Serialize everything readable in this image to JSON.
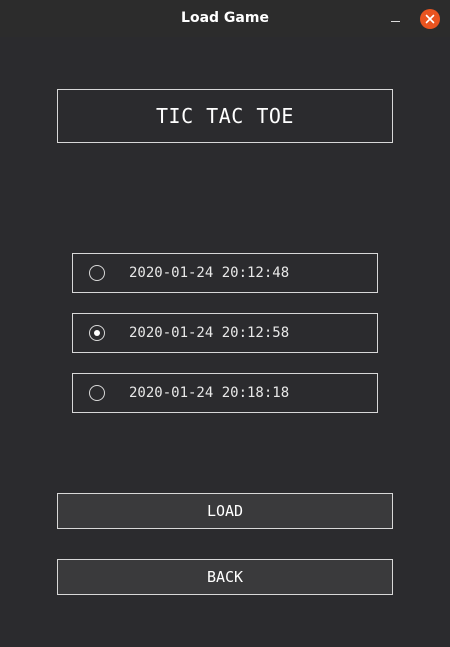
{
  "window": {
    "title": "Load Game"
  },
  "heading": "TIC TAC TOE",
  "saves": [
    {
      "label": "2020-01-24 20:12:48",
      "selected": false
    },
    {
      "label": "2020-01-24 20:12:58",
      "selected": true
    },
    {
      "label": "2020-01-24 20:18:18",
      "selected": false
    }
  ],
  "buttons": {
    "load": "LOAD",
    "back": "BACK"
  },
  "colors": {
    "background": "#2b2b2e",
    "titlebar": "#2c2c2c",
    "close_button": "#e95420",
    "border": "#d8d8d8",
    "button_fill": "#3a3a3c"
  },
  "icons": {
    "minimize": "minimize-icon",
    "close": "close-icon",
    "radio": "radio-icon"
  }
}
